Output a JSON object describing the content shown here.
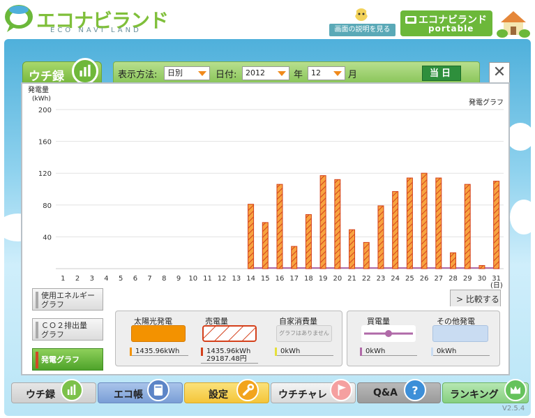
{
  "header": {
    "logo_text": "エコナビランド",
    "logo_sub": "ECO NAVI LAND",
    "help_button": "画面の説明を見る",
    "portable_title": "エコナビランド",
    "portable_sub": "portable"
  },
  "main_tab": {
    "label": "ウチ録"
  },
  "controls": {
    "display_method_label": "表示方法:",
    "display_method_value": "日別",
    "date_label": "日付:",
    "year_value": "2012",
    "year_label": "年",
    "month_value": "12",
    "month_label": "月",
    "today_button": "当日",
    "close_button": "✕"
  },
  "chart_labels": {
    "ylabel_line1": "発電量",
    "ylabel_line2": "(kWh)",
    "title": "発電グラフ",
    "x_unit": "(日)"
  },
  "chart_data": {
    "type": "bar",
    "title": "発電グラフ",
    "ylabel": "発電量 (kWh)",
    "xlabel": "(日)",
    "ylim": [
      0,
      200
    ],
    "yticks": [
      40,
      80,
      120,
      160,
      200
    ],
    "categories": [
      "1",
      "2",
      "3",
      "4",
      "5",
      "6",
      "7",
      "8",
      "9",
      "10",
      "11",
      "12",
      "13",
      "14",
      "15",
      "16",
      "17",
      "18",
      "19",
      "20",
      "21",
      "22",
      "23",
      "24",
      "25",
      "26",
      "27",
      "28",
      "29",
      "30",
      "31"
    ],
    "series": [
      {
        "name": "太陽光発電",
        "color": "#f08a1c",
        "values": [
          0,
          0,
          0,
          0,
          0,
          0,
          0,
          0,
          0,
          0,
          0,
          0,
          0,
          81,
          58,
          106,
          28,
          68,
          117,
          112,
          49,
          33,
          79,
          97,
          114,
          120,
          114,
          20,
          106,
          4,
          110
        ]
      }
    ],
    "grid": true
  },
  "side_buttons": [
    {
      "label1": "使用エネルギー",
      "label2": "グラフ"
    },
    {
      "label1": "ＣＯ２排出量",
      "label2": "グラフ"
    },
    {
      "label1": "発電グラフ",
      "label2": ""
    }
  ],
  "compare": {
    "label": "比較する",
    "arrow": ">"
  },
  "legend": {
    "solar": {
      "title": "太陽光発電",
      "value": "1435.96kWh"
    },
    "sold": {
      "title": "売電量",
      "value": "1435.96kWh",
      "value2": "29187.48円"
    },
    "self": {
      "title": "自家消費量",
      "placeholder": "グラフはありません",
      "value": "0kWh"
    },
    "bought": {
      "title": "買電量",
      "value": "0kWh"
    },
    "other": {
      "title": "その他発電",
      "value": "0kWh"
    }
  },
  "nav": [
    {
      "label": "ウチ録"
    },
    {
      "label": "エコ帳"
    },
    {
      "label": "設定"
    },
    {
      "label": "ウチチャレ"
    },
    {
      "label": "Q&A"
    },
    {
      "label": "ランキング"
    }
  ],
  "version": "V2.5.4",
  "colors": {
    "green": "#6cb83a",
    "orange": "#f08a1c",
    "bar_stroke": "#d4401b"
  }
}
